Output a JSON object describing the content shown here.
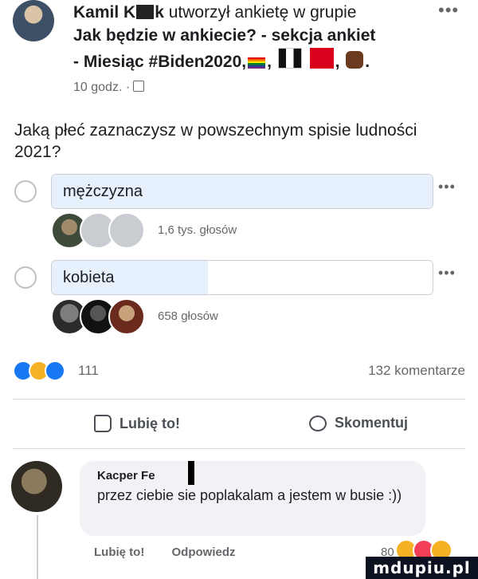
{
  "post": {
    "author": "Kamil K",
    "author_suffix": "k",
    "action_text": " utworzył ankietę w grupie",
    "group_line_1": "Jak będzie w ankiecie? - sekcja ankiet",
    "group_line_2": "- Miesiąc #Biden2020,",
    "time": "10 godz. ·",
    "question": "Jaką płeć zaznaczysz w powszechnym spisie ludności 2021?"
  },
  "poll": {
    "options": [
      {
        "label": "mężczyzna",
        "votes_text": "1,6 tys. głosów",
        "fill_fraction": 1.0
      },
      {
        "label": "kobieta",
        "votes_text": "658 głosów",
        "fill_fraction": 0.41
      }
    ]
  },
  "stats": {
    "reactions_count": "111",
    "comments": "132 komentarze"
  },
  "actions": {
    "like": "Lubię to!",
    "comment": "Skomentuj"
  },
  "comment": {
    "author": "Kacper Fe",
    "text": "przez ciebie sie poplakalam a jestem w busie :))",
    "like": "Lubię to!",
    "reply": "Odpowiedz",
    "reactions_count": "80"
  },
  "watermark": "mdupiu.pl",
  "icons": {
    "more": "more-dots-icon",
    "privacy": "globe-icon",
    "like": "thumbs-up-icon",
    "comment": "comment-bubble-icon"
  },
  "colors": {
    "accent": "#1877f2",
    "poll_fill": "#e7f0fd",
    "secondary_text": "#65676b"
  }
}
